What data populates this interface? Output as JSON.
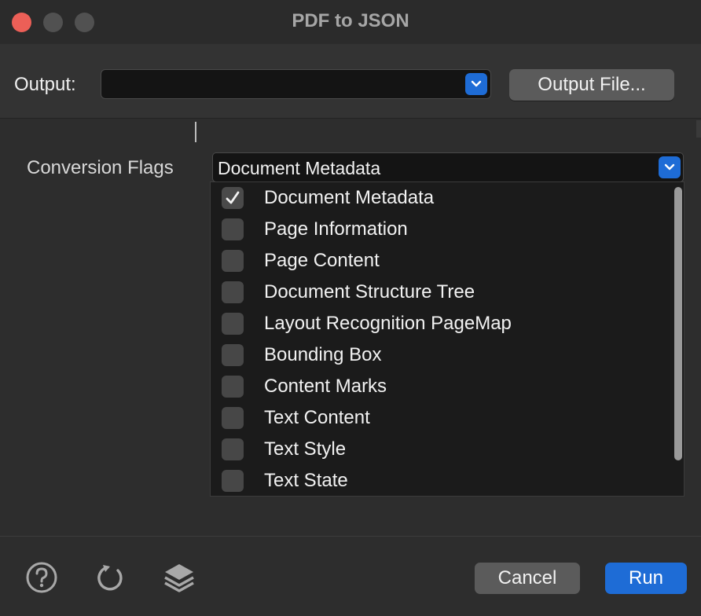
{
  "window": {
    "title": "PDF to JSON"
  },
  "output": {
    "label": "Output:",
    "value": "",
    "button_label": "Output File..."
  },
  "conversion_flags": {
    "label": "Conversion Flags",
    "selected": "Document Metadata",
    "options": [
      {
        "label": "Document Metadata",
        "checked": true
      },
      {
        "label": "Page Information",
        "checked": false
      },
      {
        "label": "Page Content",
        "checked": false
      },
      {
        "label": "Document Structure Tree",
        "checked": false
      },
      {
        "label": "Layout Recognition PageMap",
        "checked": false
      },
      {
        "label": "Bounding Box",
        "checked": false
      },
      {
        "label": "Content Marks",
        "checked": false
      },
      {
        "label": "Text Content",
        "checked": false
      },
      {
        "label": "Text Style",
        "checked": false
      },
      {
        "label": "Text State",
        "checked": false
      }
    ]
  },
  "footer": {
    "icons": [
      "help-icon",
      "reset-icon",
      "layers-icon"
    ],
    "cancel_label": "Cancel",
    "run_label": "Run"
  },
  "colors": {
    "accent": "#1e6cd6",
    "close": "#ec5f57",
    "background": "#2d2d2d"
  }
}
